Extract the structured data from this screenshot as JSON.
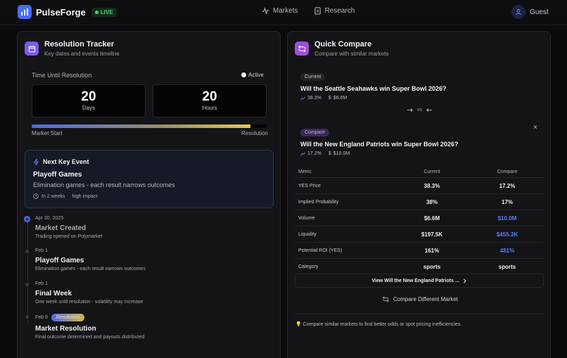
{
  "header": {
    "brand": "PulseForge",
    "live": "LIVE",
    "nav": [
      {
        "label": "Markets",
        "icon": "activity-icon"
      },
      {
        "label": "Research",
        "icon": "document-icon"
      }
    ],
    "user": "Guest"
  },
  "tracker": {
    "title": "Resolution Tracker",
    "subtitle": "Key dates and events timeline",
    "time_label": "Time Until Resolution",
    "status": "Active",
    "days_value": "20",
    "days_unit": "Days",
    "hours_value": "20",
    "hours_unit": "Hours",
    "progress": 0.93,
    "progress_start": "Market Start",
    "progress_end": "Resolution",
    "next_event": {
      "heading": "Next Key Event",
      "title": "Playoff Games",
      "desc": "Elimination games - each result narrows outcomes",
      "when": "In 2 weeks",
      "impact": "high impact"
    },
    "timeline": [
      {
        "date": "Apr 30, 2025",
        "title": "Market Created",
        "desc": "Trading opened on Polymarket"
      },
      {
        "date": "Feb 1",
        "title": "Playoff Games",
        "desc": "Elimination games - each result narrows outcomes"
      },
      {
        "date": "Feb 1",
        "title": "Final Week",
        "desc": "One week until resolution - volatility may increase"
      },
      {
        "date": "Feb 8",
        "badge": "Resolution",
        "title": "Market Resolution",
        "desc": "Final outcome determined and payouts distributed"
      }
    ]
  },
  "compare": {
    "title": "Quick Compare",
    "subtitle": "Compare with similar markets",
    "current_chip": "Current",
    "current_q": "Will the Seattle Seahawks win Super Bowl 2026?",
    "current_pct": "38.3%",
    "current_vol": "$6.6M",
    "vs": "vs",
    "compare_chip": "Compare",
    "compare_q": "Will the New England Patriots win Super Bowl 2026?",
    "compare_pct": "17.2%",
    "compare_vol": "$10.0M",
    "close": "×",
    "table_head": [
      "Metric",
      "Current",
      "Compare"
    ],
    "rows": [
      {
        "metric": "YES Price",
        "current": "38.3%",
        "compare": "17.2%",
        "highlight": false
      },
      {
        "metric": "Implied Probability",
        "current": "38%",
        "compare": "17%",
        "highlight": false
      },
      {
        "metric": "Volume",
        "current": "$6.6M",
        "compare": "$10.0M",
        "highlight": true
      },
      {
        "metric": "Liquidity",
        "current": "$197.5K",
        "compare": "$455.3K",
        "highlight": true
      },
      {
        "metric": "Potential ROI (YES)",
        "current": "161%",
        "compare": "481%",
        "highlight": true
      },
      {
        "metric": "Category",
        "current": "sports",
        "compare": "sports",
        "highlight": false
      }
    ],
    "view_button": "View Will the New England Patriots ...",
    "compare_different": "Compare Different Market",
    "tip": "Compare similar markets to find better odds or spot pricing inefficiencies.",
    "accent": "#5a7cf5"
  }
}
